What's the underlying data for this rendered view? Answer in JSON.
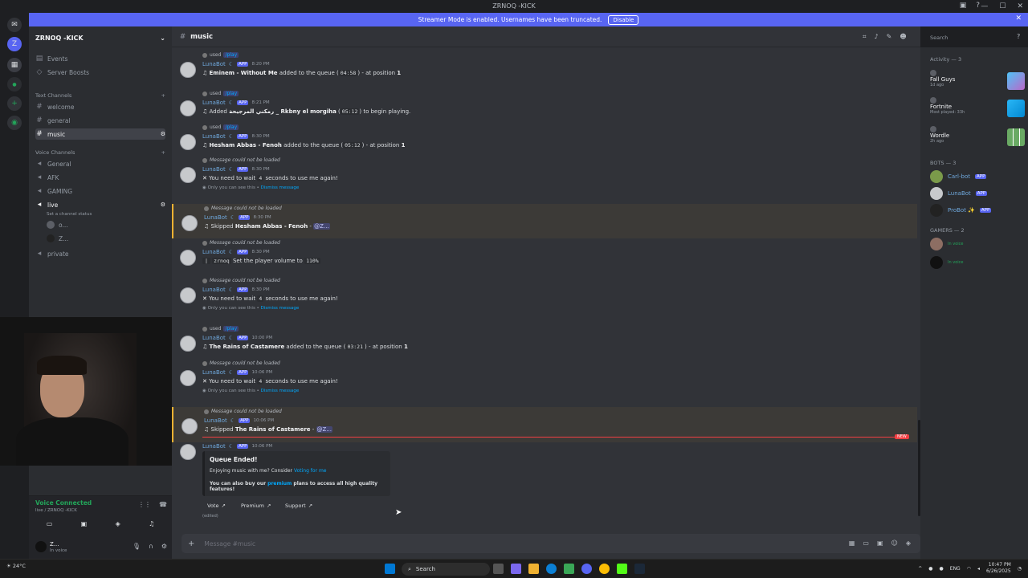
{
  "titlebar": {
    "title": "ZRNOQ -KICK"
  },
  "banner": {
    "text": "Streamer Mode is enabled. Usernames have been truncated.",
    "button": "Disable"
  },
  "sidebar": {
    "server_name": "ZRNOQ -KICK",
    "events": "Events",
    "boosts": "Server Boosts",
    "text_header": "Text Channels",
    "text_channels": [
      "welcome",
      "general",
      "music"
    ],
    "voice_header": "Voice Channels",
    "voice_channels": [
      "General",
      "AFK",
      "GAMING",
      "live",
      "private"
    ],
    "live_status": "Set a channel status",
    "live_users": [
      "o...",
      "Z..."
    ]
  },
  "voice": {
    "status": "Voice Connected",
    "channel": "live / ZRNOQ -KICK"
  },
  "user": {
    "name": "Z...",
    "status": "In voice"
  },
  "chat": {
    "channel": "music",
    "search_placeholder": "Search",
    "composer_placeholder": "Message #music",
    "messages": [
      {
        "reply": "used",
        "cmd": "/play",
        "user": "LunaBot",
        "time": "8:20 PM",
        "song": "Eminem - Without Me",
        "pre": "",
        "post": " added to the queue (",
        "dur": "04:58",
        "post2": ") - at position ",
        "pos": "1"
      },
      {
        "reply": "used",
        "cmd": "/play",
        "user": "LunaBot",
        "time": "8:21 PM",
        "text": "Added",
        "song": "رمكني المرجيحة _ Rkbny el morgiha",
        "dur": "05:12",
        "post": "to begin playing."
      },
      {
        "reply": "used",
        "cmd": "/play",
        "user": "LunaBot",
        "time": "8:30 PM",
        "song": "Hesham Abbas - Fenoh",
        "post": " added to the queue (",
        "dur": "05:12",
        "post2": ") - at position ",
        "pos": "1"
      },
      {
        "reply": "Message could not be loaded",
        "user": "LunaBot",
        "time": "8:30 PM",
        "text": "You need to wait",
        "num": "4",
        "post": "seconds to use me again!",
        "ephem": "Only you can see this •",
        "dismiss": "Dismiss message"
      },
      {
        "reply": "Message could not be loaded",
        "user": "LunaBot",
        "time": "8:30 PM",
        "text": "Skipped",
        "song": "Hesham Abbas - Fenoh",
        "mention": "@Z..."
      },
      {
        "reply": "Message could not be loaded",
        "user": "LunaBot",
        "time": "8:30 PM",
        "by": "zrnoq",
        "text": "Set the player volume to",
        "vol": "110%"
      },
      {
        "reply": "Message could not be loaded",
        "user": "LunaBot",
        "time": "8:30 PM",
        "text": "You need to wait",
        "num": "4",
        "post": "seconds to use me again!",
        "ephem": "Only you can see this •",
        "dismiss": "Dismiss message"
      },
      {
        "reply": "used",
        "cmd": "/play",
        "user": "LunaBot",
        "time": "10:00 PM",
        "song": "The Rains of Castamere",
        "post": " added to the queue (",
        "dur": "03:21",
        "post2": ") - at position ",
        "pos": "1"
      },
      {
        "reply": "Message could not be loaded",
        "user": "LunaBot",
        "time": "10:06 PM",
        "text": "You need to wait",
        "num": "4",
        "post": "seconds to use me again!",
        "ephem": "Only you can see this •",
        "dismiss": "Dismiss message"
      },
      {
        "reply": "Message could not be loaded",
        "user": "LunaBot",
        "time": "10:06 PM",
        "text": "Skipped",
        "song": "The Rains of Castamere",
        "mention": "@Z..."
      },
      {
        "user": "LunaBot",
        "time": "10:06 PM"
      }
    ],
    "app_badge": "APP",
    "new_tag": "NEW",
    "embed": {
      "title": "Queue Ended!",
      "line1": "Enjoying music with me? Consider",
      "line1_link": "Voting for me",
      "line2_pre": "You can also buy our",
      "line2_link": "premium",
      "line2_post": "plans to access all high quality features!"
    },
    "buttons": [
      "Vote",
      "Premium",
      "Support"
    ],
    "edited": "(edited)"
  },
  "members": {
    "activity_header": "Activity — 3",
    "activities": [
      {
        "name": "Fall Guys",
        "sub": "1d ago"
      },
      {
        "name": "Fortnite",
        "sub": "Most played: 33h"
      },
      {
        "name": "Wordle",
        "sub": "2h ago"
      }
    ],
    "bots_header": "BOTS — 3",
    "bots": [
      "Carl-bot",
      "LunaBot",
      "ProBot ✨"
    ],
    "gamers_header": "GAMERS — 2",
    "gamers": [
      {
        "sub": "In voice"
      },
      {
        "sub": "In voice"
      }
    ]
  },
  "taskbar": {
    "weather": "24°C",
    "search": "Search",
    "lang": "ENG",
    "time": "10:47 PM",
    "date": "6/26/2025"
  }
}
